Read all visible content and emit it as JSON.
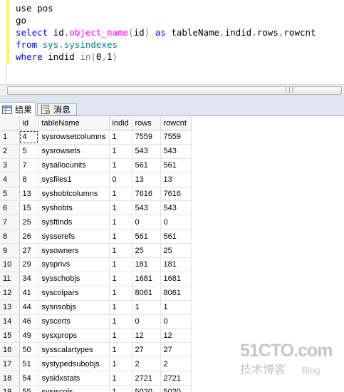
{
  "editor": {
    "lines": [
      [
        {
          "t": "use pos",
          "c": "plain"
        }
      ],
      [
        {
          "t": "go",
          "c": "plain"
        }
      ],
      [
        {
          "t": "select ",
          "c": "kw"
        },
        {
          "t": "id",
          "c": "plain"
        },
        {
          "t": ",",
          "c": "gray"
        },
        {
          "t": "object_name",
          "c": "fn"
        },
        {
          "t": "(",
          "c": "gray"
        },
        {
          "t": "id",
          "c": "plain"
        },
        {
          "t": ")",
          "c": "gray"
        },
        {
          "t": " as ",
          "c": "kw"
        },
        {
          "t": "tableName",
          "c": "plain"
        },
        {
          "t": ",",
          "c": "gray"
        },
        {
          "t": "indid",
          "c": "plain"
        },
        {
          "t": ",",
          "c": "gray"
        },
        {
          "t": "rows",
          "c": "plain"
        },
        {
          "t": ",",
          "c": "gray"
        },
        {
          "t": "rowcnt",
          "c": "plain"
        }
      ],
      [
        {
          "t": "from ",
          "c": "kw"
        },
        {
          "t": "sys",
          "c": "obj"
        },
        {
          "t": ".",
          "c": "gray"
        },
        {
          "t": "sysindexes",
          "c": "obj"
        }
      ],
      [
        {
          "t": "where ",
          "c": "kw"
        },
        {
          "t": "indid ",
          "c": "plain"
        },
        {
          "t": "in",
          "c": "gray"
        },
        {
          "t": "(",
          "c": "gray"
        },
        {
          "t": "0",
          "c": "plain"
        },
        {
          "t": ",",
          "c": "gray"
        },
        {
          "t": "1",
          "c": "plain"
        },
        {
          "t": ")",
          "c": "gray"
        }
      ]
    ]
  },
  "scrollbar": {
    "grip": "|||"
  },
  "tabs": {
    "results_label": "结果",
    "messages_label": "消息"
  },
  "grid": {
    "columns": [
      "id",
      "tableName",
      "indid",
      "rows",
      "rowcnt"
    ],
    "rows": [
      [
        "1",
        "4",
        "sysrowsetcolumns",
        "1",
        "7559",
        "7559"
      ],
      [
        "2",
        "5",
        "sysrowsets",
        "1",
        "543",
        "543"
      ],
      [
        "3",
        "7",
        "sysallocunits",
        "1",
        "561",
        "561"
      ],
      [
        "4",
        "8",
        "sysfiles1",
        "0",
        "13",
        "13"
      ],
      [
        "5",
        "13",
        "syshobtcolumns",
        "1",
        "7616",
        "7616"
      ],
      [
        "6",
        "15",
        "syshobts",
        "1",
        "543",
        "543"
      ],
      [
        "7",
        "25",
        "sysftinds",
        "1",
        "0",
        "0"
      ],
      [
        "8",
        "26",
        "sysserefs",
        "1",
        "561",
        "561"
      ],
      [
        "9",
        "27",
        "sysowners",
        "1",
        "25",
        "25"
      ],
      [
        "10",
        "29",
        "sysprivs",
        "1",
        "181",
        "181"
      ],
      [
        "11",
        "34",
        "sysschobjs",
        "1",
        "1681",
        "1681"
      ],
      [
        "12",
        "41",
        "syscolpars",
        "1",
        "8061",
        "8061"
      ],
      [
        "13",
        "44",
        "sysnsobjs",
        "1",
        "1",
        "1"
      ],
      [
        "14",
        "46",
        "syscerts",
        "1",
        "0",
        "0"
      ],
      [
        "15",
        "49",
        "sysxprops",
        "1",
        "12",
        "12"
      ],
      [
        "16",
        "50",
        "sysscalartypes",
        "1",
        "27",
        "27"
      ],
      [
        "17",
        "51",
        "systypedsubobjs",
        "1",
        "2",
        "2"
      ],
      [
        "18",
        "54",
        "sysidxstats",
        "1",
        "2721",
        "2721"
      ],
      [
        "19",
        "55",
        "sysiscols",
        "1",
        "5020",
        "5020"
      ]
    ]
  },
  "watermark": {
    "top": "51CTO.com",
    "bottom_cn": "技术博客",
    "bottom_en": "Blog"
  }
}
